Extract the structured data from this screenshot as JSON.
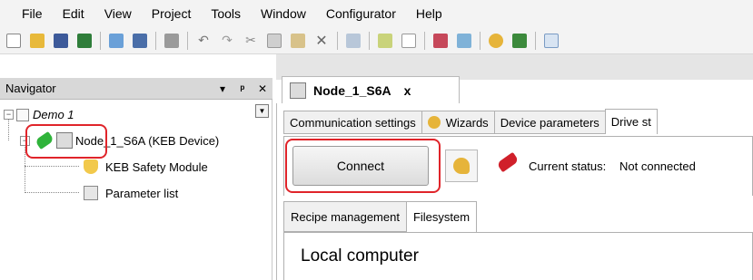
{
  "menu": [
    "File",
    "Edit",
    "View",
    "Project",
    "Tools",
    "Window",
    "Configurator",
    "Help"
  ],
  "toolbar_icons": [
    "new-icon",
    "open-icon",
    "save-icon",
    "import-icon",
    "keb-config-icon",
    "keb-save-icon",
    "print-icon",
    "undo-icon",
    "redo-icon",
    "cut-icon",
    "copy-icon",
    "paste-icon",
    "delete-icon",
    "keb-device-icon",
    "add-node-icon",
    "page-icon",
    "keb-param-icon",
    "keb-compare-icon",
    "key-icon",
    "export-icon",
    "chart-icon"
  ],
  "navigator": {
    "title": "Navigator",
    "pin_glyph": "▾  ᵖ",
    "tree": {
      "project": "Demo 1",
      "node": "Node_1_S6A (KEB Device)",
      "children": [
        "KEB Safety Module",
        "Parameter list"
      ]
    }
  },
  "document_tab": {
    "label": "Node_1_S6A",
    "close": "x"
  },
  "subtabs": [
    "Communication settings",
    "Wizards",
    "Device parameters",
    "Drive st"
  ],
  "connect": {
    "button_label": "Connect",
    "status_label": "Current status:",
    "status_value": "Not connected"
  },
  "inner_tabs": [
    "Recipe management",
    "Filesystem"
  ],
  "panel_heading": "Local computer",
  "colors": {
    "highlight": "#e0242a",
    "connected_green": "#2fb33a",
    "plug_red": "#d0202a"
  }
}
